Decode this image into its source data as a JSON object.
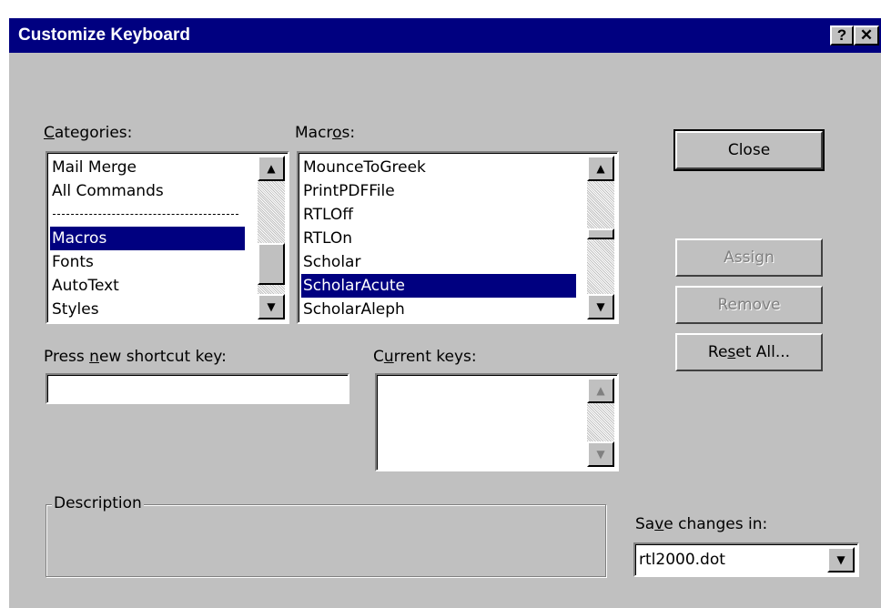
{
  "window": {
    "title": "Customize Keyboard",
    "help_glyph": "?",
    "close_glyph": "✕"
  },
  "categories": {
    "label_pre": "",
    "label_u": "C",
    "label_post": "ategories:",
    "items": [
      "Mail Merge",
      "All Commands",
      "",
      "Macros",
      "Fonts",
      "AutoText",
      "Styles"
    ],
    "selected": "Macros"
  },
  "macros": {
    "label_pre": "Macr",
    "label_u": "o",
    "label_post": "s:",
    "items": [
      "MounceToGreek",
      "PrintPDFFile",
      "RTLOff",
      "RTLOn",
      "Scholar",
      "ScholarAcute",
      "ScholarAleph"
    ],
    "selected": "ScholarAcute"
  },
  "shortcut": {
    "label_pre": "Press ",
    "label_u": "n",
    "label_post": "ew shortcut key:",
    "value": ""
  },
  "current_keys": {
    "label_pre": "C",
    "label_u": "u",
    "label_post": "rrent keys:"
  },
  "description": {
    "label": "Description"
  },
  "save_in": {
    "label_pre": "Sa",
    "label_u": "v",
    "label_post": "e changes in:",
    "value": "rtl2000.dot"
  },
  "buttons": {
    "close": "Close",
    "assign": "Assign",
    "remove": "Remove",
    "reset_pre": "Re",
    "reset_u": "s",
    "reset_post": "et All..."
  },
  "icons": {
    "scroll_up": "up-arrow-icon",
    "scroll_down": "down-arrow-icon"
  }
}
